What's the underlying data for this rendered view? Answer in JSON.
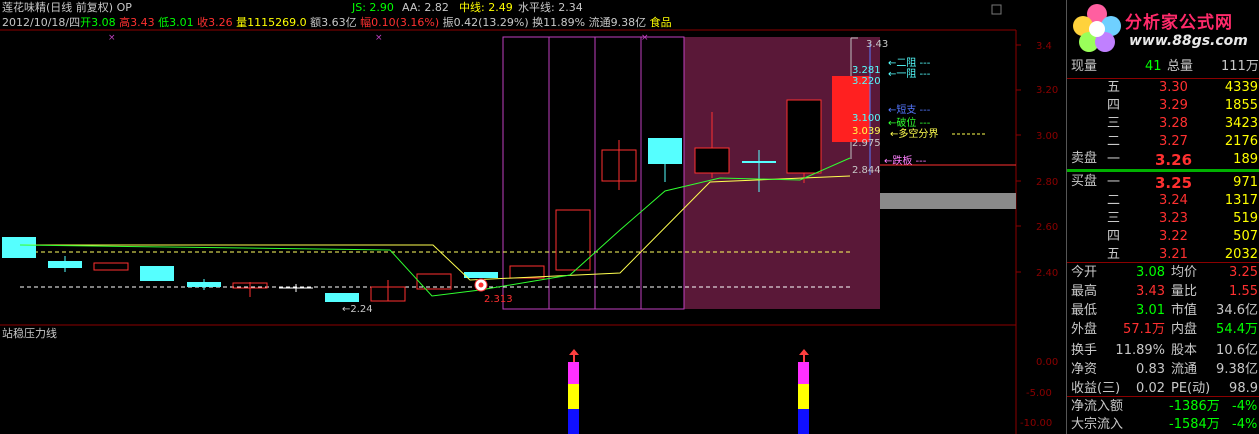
{
  "header": {
    "line1": [
      {
        "text": "莲花味精(日线 前复权) OP",
        "color": "#c8c8c8"
      },
      {
        "text": "JS: 2.90",
        "color": "#00ff00"
      },
      {
        "text": "AA: 2.82",
        "color": "#c8c8c8"
      },
      {
        "text": "中线: 2.49",
        "color": "#ffff00"
      },
      {
        "text": "水平线: 2.34",
        "color": "#c8c8c8"
      }
    ],
    "line2": [
      {
        "text": "2012/10/18/四",
        "color": "#c8c8c8"
      },
      {
        "text": "开3.08",
        "color": "#00ff00"
      },
      {
        "text": "高3.43",
        "color": "#ff3030"
      },
      {
        "text": "低3.01",
        "color": "#00ff00"
      },
      {
        "text": "收3.26",
        "color": "#ff3030"
      },
      {
        "text": "量1115269.0",
        "color": "#ffff00"
      },
      {
        "text": "额3.63亿",
        "color": "#c8c8c8"
      },
      {
        "text": "幅0.10(3.16%)",
        "color": "#ff3030"
      },
      {
        "text": "振0.42(13.29%)",
        "color": "#c8c8c8"
      },
      {
        "text": "换11.89%",
        "color": "#c8c8c8"
      },
      {
        "text": "流通9.38亿",
        "color": "#c8c8c8"
      },
      {
        "text": "食品",
        "color": "#ffff00"
      }
    ]
  },
  "indicator_title": "站稳压力线",
  "price_axis": [
    "3.4",
    "3.20",
    "3.00",
    "2.80",
    "2.60",
    "2.40"
  ],
  "indicator_axis": [
    "0.00",
    "-5.00",
    "-10.00"
  ],
  "annotations": {
    "p343": "3.43",
    "p3281": "3.281",
    "p3220": "3.220",
    "lbl_ermo": "←二阻 ---",
    "lbl_yizu": "←一阻 ---",
    "lbl_duanzhi": "←短支 ---",
    "lbl_powei": "←破位 ---",
    "p3100": "3.100",
    "p3039": "3.039",
    "lbl_duokong": "←多空分界",
    "p2975": "2.975",
    "lbl_dieban": "←跌板 ---",
    "p2844": "2.844",
    "low224": "←2.24",
    "low2313": "2.313"
  },
  "right_panel": {
    "logo_text": "分析家公式网",
    "logo_url": "www.88gs.com",
    "xianliang_label": "现量",
    "xianliang_val": "41",
    "zongliang_label": "总量",
    "zongliang_val": "111万",
    "sell": [
      {
        "label": "五",
        "price": "3.30",
        "vol": "4339"
      },
      {
        "label": "四",
        "price": "3.29",
        "vol": "1855"
      },
      {
        "label": "三",
        "price": "3.28",
        "vol": "3423"
      },
      {
        "label": "二",
        "price": "3.27",
        "vol": "2176"
      },
      {
        "label": "一",
        "price": "3.26",
        "vol": "189"
      }
    ],
    "maipan_label": "卖盘",
    "maipan2_label": "买盘",
    "buy": [
      {
        "label": "一",
        "price": "3.25",
        "vol": "971"
      },
      {
        "label": "二",
        "price": "3.24",
        "vol": "1317"
      },
      {
        "label": "三",
        "price": "3.23",
        "vol": "519"
      },
      {
        "label": "四",
        "price": "3.22",
        "vol": "507"
      },
      {
        "label": "五",
        "price": "3.21",
        "vol": "2032"
      }
    ],
    "stats": [
      {
        "l1": "今开",
        "v1": "3.08",
        "c1": "#00ff00",
        "l2": "均价",
        "v2": "3.25",
        "c2": "#ff3030"
      },
      {
        "l1": "最高",
        "v1": "3.43",
        "c1": "#ff3030",
        "l2": "量比",
        "v2": "1.55",
        "c2": "#ff3030"
      },
      {
        "l1": "最低",
        "v1": "3.01",
        "c1": "#00ff00",
        "l2": "市值",
        "v2": "34.6亿",
        "c2": "#c8c8c8"
      },
      {
        "l1": "外盘",
        "v1": "57.1万",
        "c1": "#ff3030",
        "l2": "内盘",
        "v2": "54.4万",
        "c2": "#00ff00"
      },
      {
        "l1": "换手",
        "v1": "11.89%",
        "c1": "#c8c8c8",
        "l2": "股本",
        "v2": "10.6亿",
        "c2": "#c8c8c8"
      },
      {
        "l1": "净资",
        "v1": "0.83",
        "c1": "#c8c8c8",
        "l2": "流通",
        "v2": "9.38亿",
        "c2": "#c8c8c8"
      },
      {
        "l1": "收益(三)",
        "v1": "0.02",
        "c1": "#c8c8c8",
        "l2": "PE(动)",
        "v2": "98.9",
        "c2": "#c8c8c8"
      }
    ],
    "jingliuru_label": "净流入额",
    "jingliuru_val": "-1386万",
    "jingliuru_pct": "-4%",
    "dazong_label": "大宗流入",
    "dazong_val": "-1584万",
    "dazong_pct": "-4%"
  }
}
